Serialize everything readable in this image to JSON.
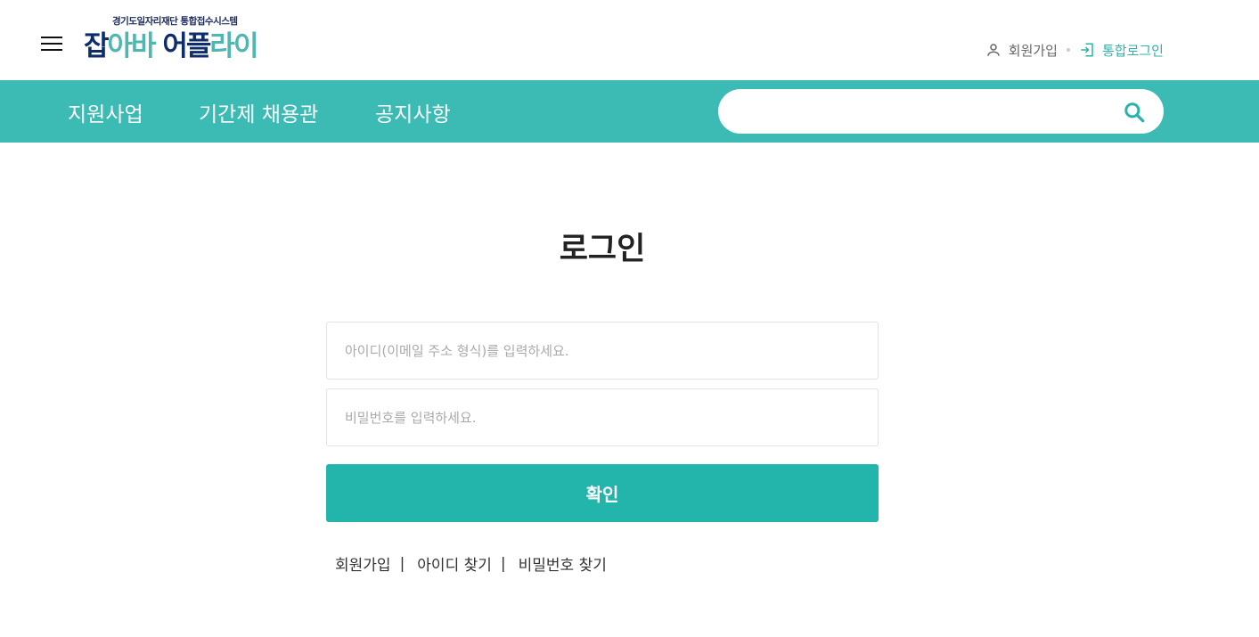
{
  "header": {
    "logo_sub": "경기도일자리재단 통합접수시스템",
    "logo_main_part1": "잡",
    "logo_main_part2": "아바",
    "logo_main_part3": " 어",
    "logo_main_part4": "플",
    "logo_main_part5": "라이",
    "join_label": "회원가입",
    "login_label": "통합로그인"
  },
  "nav": {
    "items": [
      "지원사업",
      "기간제 채용관",
      "공지사항"
    ],
    "search_placeholder": ""
  },
  "login": {
    "title": "로그인",
    "id_placeholder": "아이디(이메일 주소 형식)를 입력하세요.",
    "pw_placeholder": "비밀번호를 입력하세요.",
    "confirm_label": "확인",
    "links": [
      "회원가입",
      "아이디 찾기",
      "비밀번호 찾기"
    ],
    "separator": "|"
  },
  "colors": {
    "nav_bg": "#3bbbb3",
    "button_bg": "#23b4ab",
    "login_link": "#2ab3aa",
    "logo_navy": "#0f2d6b",
    "logo_teal": "#4fb7b0"
  },
  "icons": [
    "hamburger-menu-icon",
    "user-icon",
    "login-icon",
    "search-icon"
  ]
}
